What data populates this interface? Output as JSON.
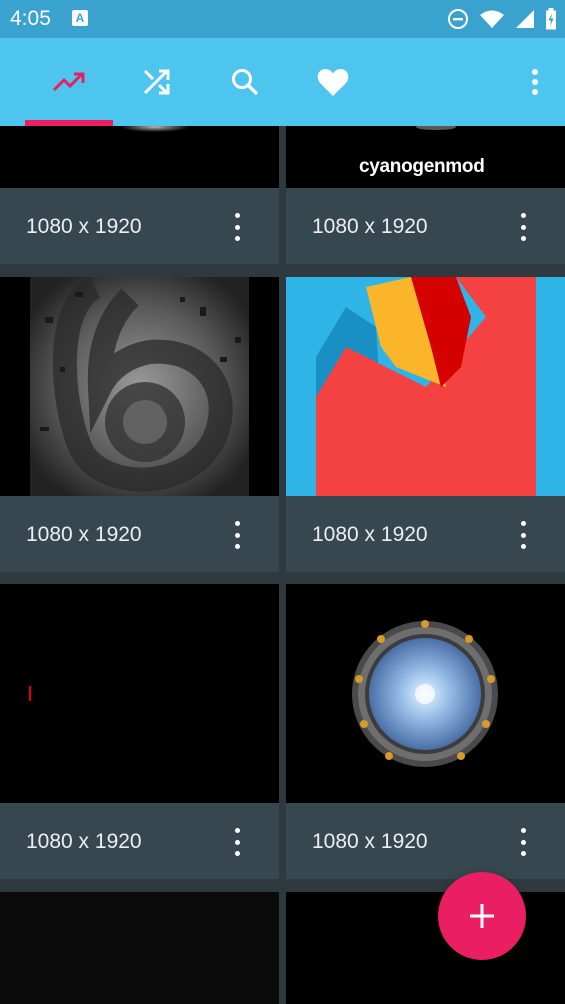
{
  "status_bar": {
    "time": "4:05",
    "notification_icon": "a-icon",
    "icons": [
      "do-not-disturb-icon",
      "wifi-icon",
      "signal-icon",
      "battery-icon"
    ]
  },
  "toolbar": {
    "tabs": [
      {
        "name": "trending",
        "icon": "trending-up-icon",
        "selected": true
      },
      {
        "name": "random",
        "icon": "shuffle-icon",
        "selected": false
      },
      {
        "name": "search",
        "icon": "search-icon",
        "selected": false
      },
      {
        "name": "favorites",
        "icon": "heart-icon",
        "selected": false
      }
    ],
    "colors": {
      "background": "#4ec5ee",
      "accent": "#e91e63"
    }
  },
  "wallpapers": [
    {
      "resolution": "1080 x 1920",
      "overlay_text": ""
    },
    {
      "resolution": "1080 x 1920",
      "overlay_text": "cyanogenmod"
    },
    {
      "resolution": "1080 x 1920"
    },
    {
      "resolution": "1080 x 1920"
    },
    {
      "resolution": "1080 x 1920"
    },
    {
      "resolution": "1080 x 1920"
    },
    {
      "resolution": "",
      "partial": true
    },
    {
      "resolution": "",
      "partial": true
    }
  ],
  "fab": {
    "icon": "plus-icon",
    "color": "#e91e63"
  }
}
